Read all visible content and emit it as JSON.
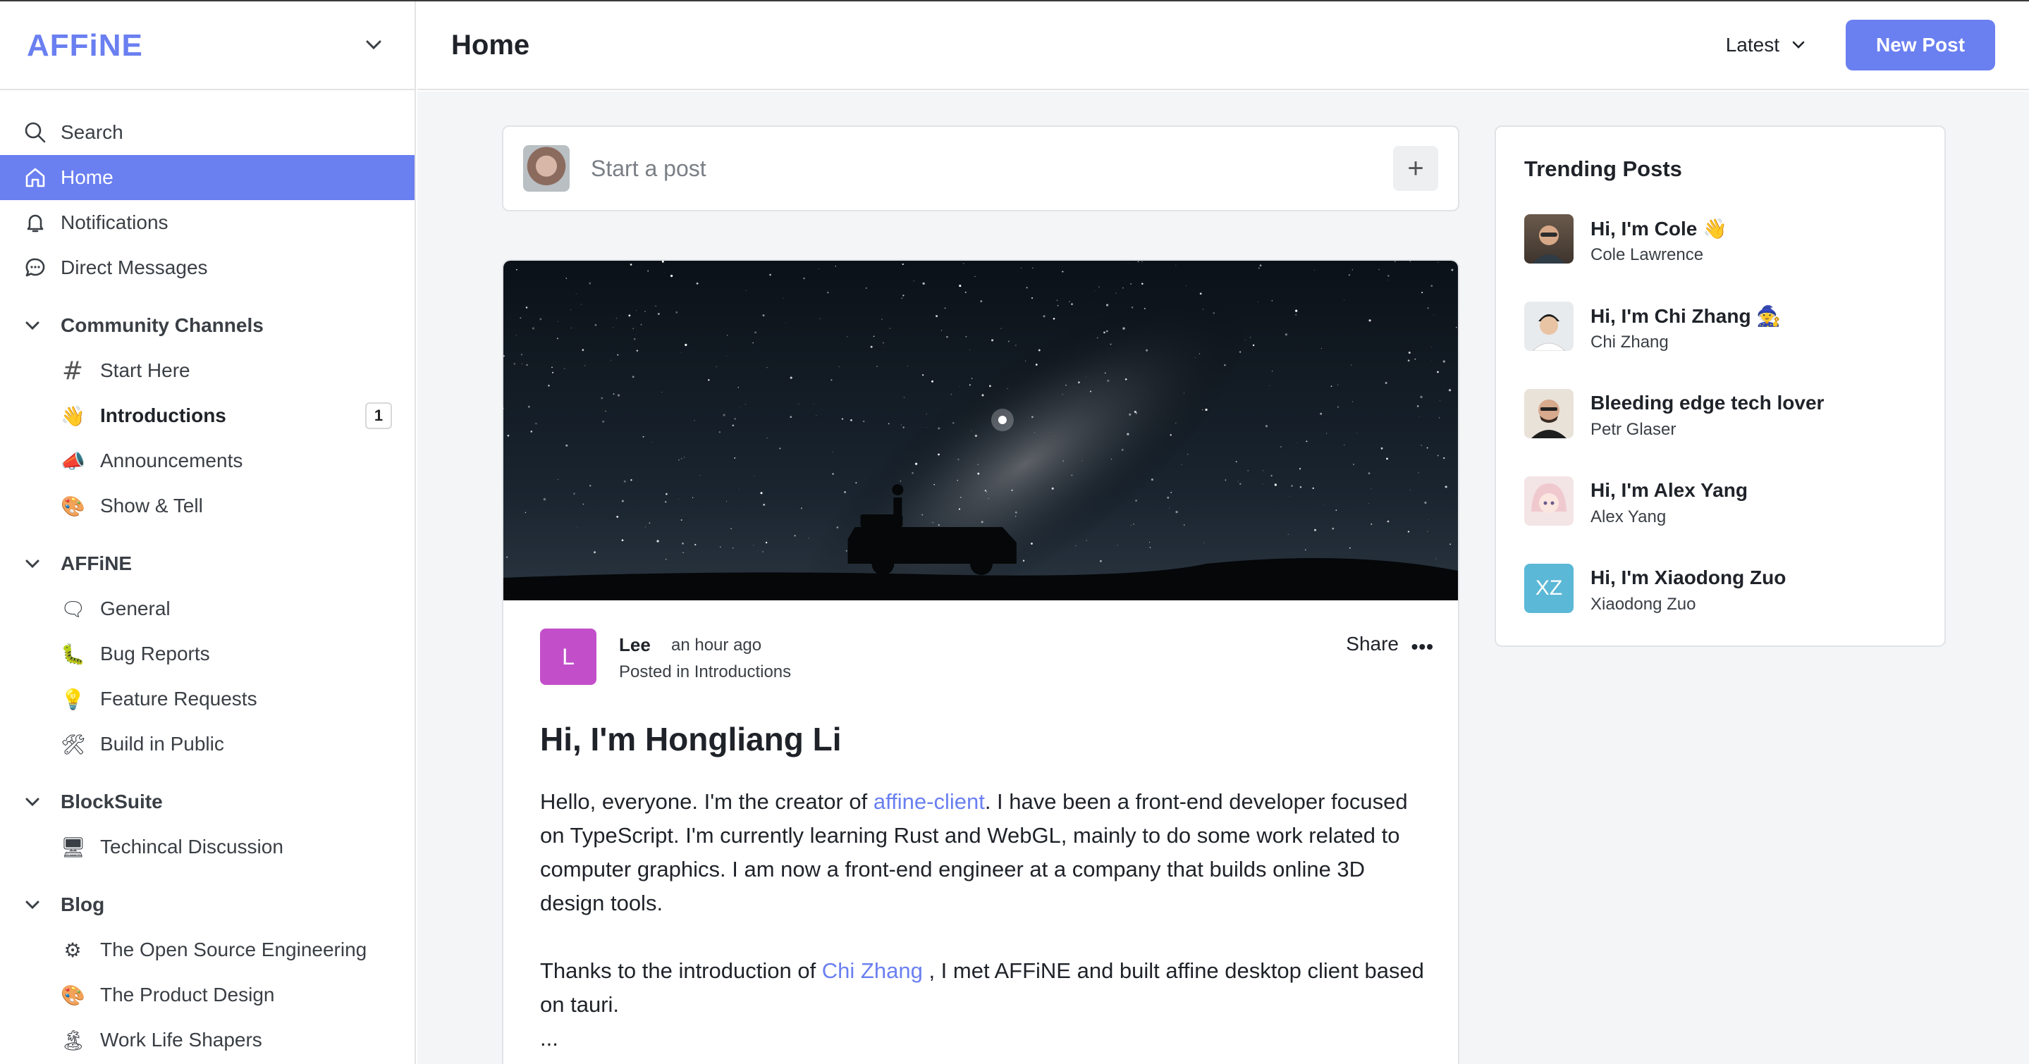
{
  "app": {
    "logo_text": "AFFiNE"
  },
  "header": {
    "title": "Home",
    "sort_label": "Latest",
    "new_post_label": "New Post"
  },
  "sidebar": {
    "nav": [
      {
        "label": "Search",
        "icon": "search-icon"
      },
      {
        "label": "Home",
        "icon": "home-icon",
        "active": true
      },
      {
        "label": "Notifications",
        "icon": "bell-icon"
      },
      {
        "label": "Direct Messages",
        "icon": "chat-bubble-icon"
      }
    ],
    "sections": [
      {
        "title": "Community Channels",
        "items": [
          {
            "label": "Start Here",
            "emoji": "#"
          },
          {
            "label": "Introductions",
            "emoji": "👋",
            "badge": "1",
            "bold": true
          },
          {
            "label": "Announcements",
            "emoji": "📣"
          },
          {
            "label": "Show & Tell",
            "emoji": "🎨"
          }
        ]
      },
      {
        "title": "AFFiNE",
        "items": [
          {
            "label": "General",
            "emoji": "🗨"
          },
          {
            "label": "Bug Reports",
            "emoji": "🐛"
          },
          {
            "label": "Feature Requests",
            "emoji": "💡"
          },
          {
            "label": "Build in Public",
            "emoji": "🛠"
          }
        ]
      },
      {
        "title": "BlockSuite",
        "items": [
          {
            "label": "Techincal Discussion",
            "emoji": "🖥"
          }
        ]
      },
      {
        "title": "Blog",
        "items": [
          {
            "label": "The Open Source Engineering",
            "emoji": "⚙"
          },
          {
            "label": "The Product Design",
            "emoji": "🎨"
          },
          {
            "label": "Work Life Shapers",
            "emoji": "🏝"
          }
        ]
      }
    ]
  },
  "composer": {
    "placeholder": "Start a post",
    "plus": "+"
  },
  "post": {
    "avatar_letter": "L",
    "author": "Lee",
    "time": "an hour ago",
    "posted_in": "Posted in Introductions",
    "share_label": "Share",
    "more_label": "•••",
    "title": "Hi, I'm Hongliang Li",
    "p1_a": "Hello, everyone. I'm the creator of ",
    "p1_link": "affine-client",
    "p1_b": ". I have been a front-end developer focused on TypeScript. I'm currently learning Rust and WebGL, mainly to do some work related to computer graphics. I am now a front-end engineer at a company that builds online 3D design tools.",
    "p2_a": "Thanks to the introduction of ",
    "p2_link": "Chi Zhang",
    "p2_b": " , I met AFFiNE and built affine desktop client based on tauri.",
    "ellipsis": "..."
  },
  "trending": {
    "title": "Trending Posts",
    "items": [
      {
        "title": "Hi, I'm Cole 👋",
        "name": "Cole Lawrence"
      },
      {
        "title": "Hi, I'm Chi Zhang 🧙",
        "name": "Chi Zhang"
      },
      {
        "title": "Bleeding edge tech lover",
        "name": "Petr Glaser"
      },
      {
        "title": "Hi, I'm Alex Yang",
        "name": "Alex Yang"
      },
      {
        "title": "Hi, I'm Xiaodong Zuo",
        "name": "Xiaodong Zuo",
        "initials": "XZ"
      }
    ]
  },
  "colors": {
    "accent": "#6a7ff0",
    "post_avatar": "#c24fc9",
    "xz_avatar": "#5bb8d6"
  }
}
